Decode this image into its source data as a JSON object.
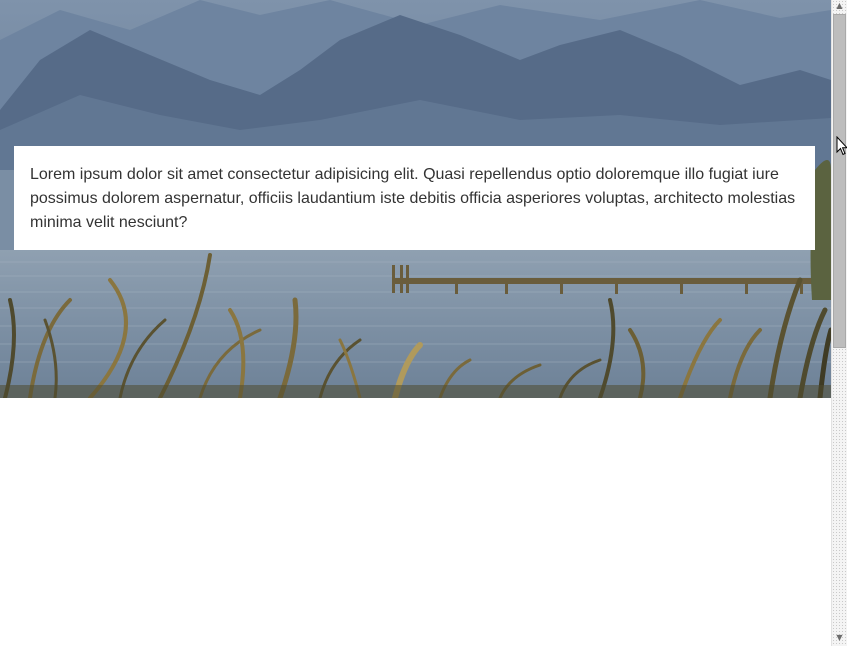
{
  "page": {
    "background_color": "#ffffff"
  },
  "hero": {
    "image": "lake-with-mountains-pier-and-reeds",
    "text": "Lorem ipsum dolor sit amet consectetur adipisicing elit. Quasi repellendus optio doloremque illo fugiat iure possimus dolorem aspernatur, officiis laudantium iste debitis officia asperiores voluptas, architecto molestias minima velit nesciunt?"
  },
  "scrollbar": {
    "up_arrow": "▲",
    "down_arrow": "▼",
    "position": 0.0
  },
  "colors": {
    "card_background": "#ffffff",
    "text": "#333333",
    "sky_mountains": "#5e7391",
    "water": "#8194a6",
    "reeds": "#7a6a3c"
  }
}
